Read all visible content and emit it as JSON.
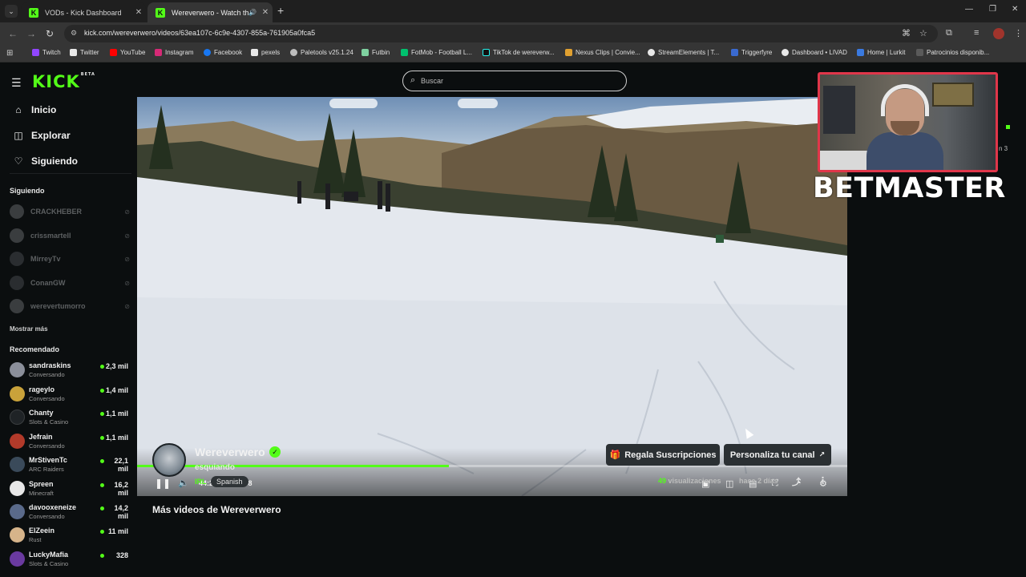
{
  "browser": {
    "tabs": [
      {
        "label": "VODs - Kick Dashboard",
        "active": false
      },
      {
        "label": "Wereverwero - Watch the V",
        "active": true
      }
    ],
    "url": "kick.com/wereverwero/videos/63ea107c-6c9e-4307-855a-761905a0fca5",
    "bookmarks": [
      "Twitch",
      "Twitter",
      "YouTube",
      "Instagram",
      "Facebook",
      "pexels",
      "Paletools v25.1.24",
      "Futbin",
      "FotMob - Football L...",
      "TikTok de wereverw...",
      "Nexus Clips | Convie...",
      "StreamElements | T...",
      "Triggerfyre",
      "Dashboard • LIVAD",
      "Home | Lurkit",
      "Patrocinios disponib..."
    ]
  },
  "kick": {
    "logo": "KICK",
    "logo_badge": "BETA",
    "search_placeholder": "Buscar",
    "nav": [
      {
        "label": "Inicio",
        "icon": "home-icon"
      },
      {
        "label": "Explorar",
        "icon": "compass-icon"
      },
      {
        "label": "Siguiendo",
        "icon": "heart-icon"
      }
    ],
    "following_title": "Siguiendo",
    "following": [
      "CRACKHEBER",
      "crissmartell",
      "MirreyTv",
      "ConanGW",
      "werevertumorro"
    ],
    "show_more": "Mostrar más",
    "recommended_title": "Recomendado",
    "recommended": [
      {
        "name": "sandraskins",
        "category": "Conversando",
        "viewers": "2,3 mil",
        "color": "#8b8f9a"
      },
      {
        "name": "rageylo",
        "category": "Conversando",
        "viewers": "1,4 mil",
        "color": "#c9a23a"
      },
      {
        "name": "Chanty",
        "category": "Slots & Casino",
        "viewers": "1,1 mil",
        "color": "#1f2326"
      },
      {
        "name": "Jefrain",
        "category": "Conversando",
        "viewers": "1,1 mil",
        "color": "#b23a2a"
      },
      {
        "name": "MrStivenTc",
        "category": "ARC Raiders",
        "viewers": "22,1 mil",
        "color": "#3a4a5a"
      },
      {
        "name": "Spreen",
        "category": "Minecraft",
        "viewers": "16,2 mil",
        "color": "#e8e8e8"
      },
      {
        "name": "davooxeneize",
        "category": "Conversando",
        "viewers": "14,2 mil",
        "color": "#5a6a8a"
      },
      {
        "name": "ElZeein",
        "category": "Rust",
        "viewers": "11 mil",
        "color": "#d6b48a"
      },
      {
        "name": "LuckyMafia",
        "category": "Slots & Casino",
        "viewers": "328",
        "color": "#6a3aa0"
      }
    ]
  },
  "player": {
    "time": "44:21 / 01:40:58",
    "progress_fraction": 0.439
  },
  "channel": {
    "name": "Wereverwero",
    "video_title": "esquiando",
    "category": "IRL",
    "language": "Spanish",
    "gift_button": "Regala Suscripciones",
    "customize_button": "Personaliza tu canal",
    "views_count": "49",
    "views_label": "visualizaciones",
    "posted": "hace 2 días",
    "more_videos": "Más videos de Wereverwero"
  },
  "overlay": {
    "sponsor": "BETMASTER",
    "chat_fragment": "n 3"
  },
  "colors": {
    "kick_green": "#53fc18",
    "cam_border": "#e0364a",
    "page_bg": "#0b0e0f"
  }
}
